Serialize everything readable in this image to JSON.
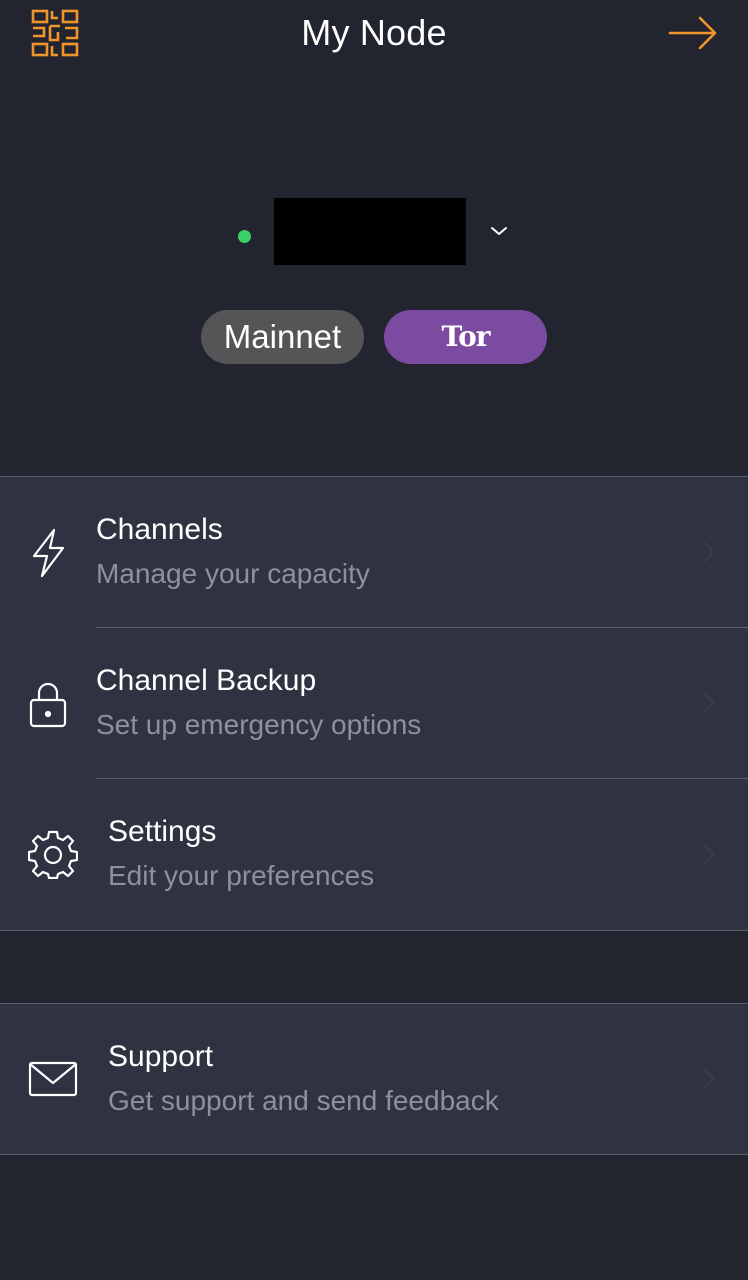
{
  "header": {
    "title": "My Node",
    "left_icon": "qr-code-icon",
    "right_icon": "arrow-right-icon"
  },
  "node": {
    "status": "online",
    "status_color": "#37d36a",
    "name_redacted": true,
    "dropdown_icon": "chevron-down-icon"
  },
  "badges": {
    "network": "Mainnet",
    "tor": "Tor"
  },
  "menu": {
    "items": [
      {
        "label": "Channels",
        "subtitle": "Manage your capacity",
        "icon": "lightning-bolt-icon"
      },
      {
        "label": "Channel Backup",
        "subtitle": "Set up emergency options",
        "icon": "lock-icon"
      },
      {
        "label": "Settings",
        "subtitle": "Edit your preferences",
        "icon": "gear-icon"
      }
    ]
  },
  "support": {
    "label": "Support",
    "subtitle": "Get support and send feedback",
    "icon": "envelope-icon"
  },
  "colors": {
    "background": "#22252f",
    "card": "#2f3241",
    "accent_orange": "#f0952b",
    "tor_purple": "#7b4ba2",
    "mainnet_gray": "#555557"
  }
}
